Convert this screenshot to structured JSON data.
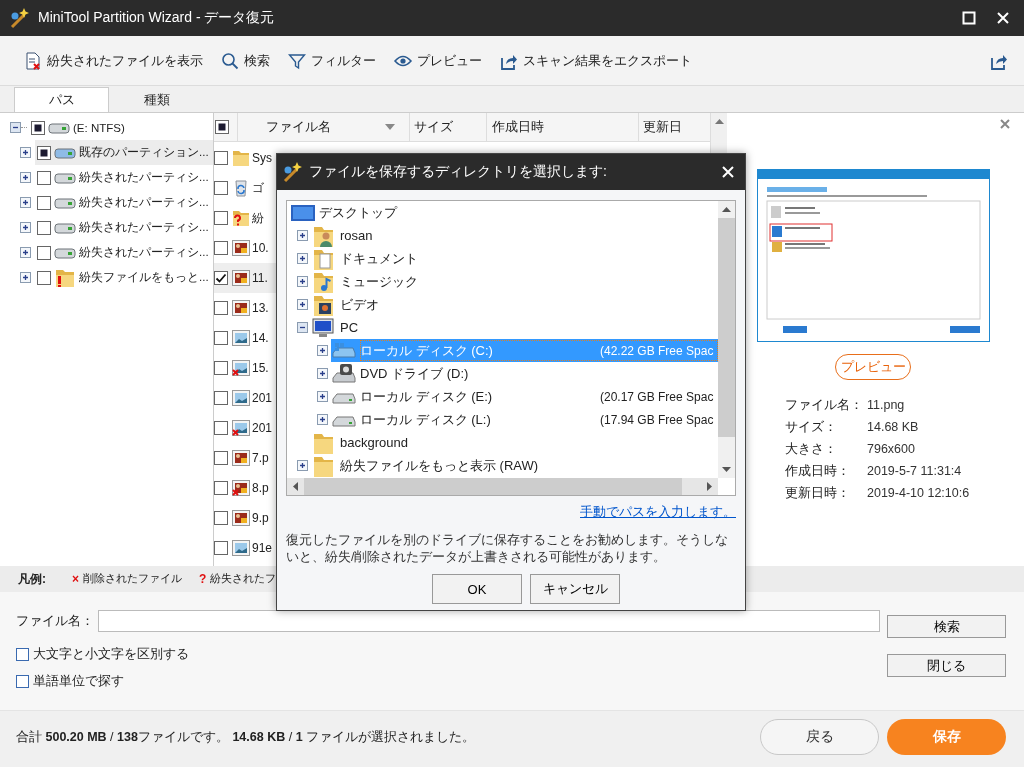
{
  "window": {
    "title": "MiniTool Partition Wizard - データ復元"
  },
  "toolbar": {
    "items": [
      {
        "kind": "show-lost",
        "label": "紛失されたファイルを表示"
      },
      {
        "kind": "search",
        "label": "検索"
      },
      {
        "kind": "filter",
        "label": "フィルター"
      },
      {
        "kind": "preview",
        "label": "プレビュー"
      },
      {
        "kind": "export",
        "label": "スキャン結果をエクスポート"
      }
    ]
  },
  "tabs": [
    {
      "label": "パス",
      "selected": true
    },
    {
      "label": "種類",
      "selected": false
    }
  ],
  "tree": {
    "label": "(E: NTFS)",
    "checked": false,
    "indeterminate": true,
    "expanded": true,
    "children": [
      {
        "label": "既存のパーティション...",
        "kind": "partition",
        "checked": false,
        "indeterminate": true,
        "expanded": false,
        "selected": true
      },
      {
        "label": "紛失されたパーティシ...",
        "kind": "drive",
        "checked": false,
        "indeterminate": false,
        "expanded": false,
        "selected": false
      },
      {
        "label": "紛失されたパーティシ...",
        "kind": "drive",
        "checked": false,
        "indeterminate": false,
        "expanded": false,
        "selected": false
      },
      {
        "label": "紛失されたパーティシ...",
        "kind": "drive",
        "checked": false,
        "indeterminate": false,
        "expanded": false,
        "selected": false
      },
      {
        "label": "紛失されたパーティシ...",
        "kind": "drive",
        "checked": false,
        "indeterminate": false,
        "expanded": false,
        "selected": false
      },
      {
        "label": "紛失ファイルをもっと...",
        "kind": "lost-folder",
        "checked": false,
        "indeterminate": false,
        "expanded": false,
        "selected": false
      }
    ]
  },
  "file_list": {
    "header_checked": false,
    "header_indeterminate": true,
    "columns": [
      "ファイル名",
      "サイズ",
      "作成日時",
      "更新日"
    ],
    "rows": [
      {
        "name": "Sys",
        "kind": "folder",
        "checked": false,
        "selected": false
      },
      {
        "name": "ゴ",
        "kind": "recycle-bin",
        "checked": false,
        "selected": false
      },
      {
        "name": "紛",
        "kind": "lost-folder",
        "checked": false,
        "selected": false
      },
      {
        "name": "10.",
        "kind": "photo",
        "checked": false,
        "selected": false
      },
      {
        "name": "11.",
        "kind": "photo",
        "checked": true,
        "selected": true
      },
      {
        "name": "13.",
        "kind": "photo",
        "checked": false,
        "selected": false
      },
      {
        "name": "14.",
        "kind": "landscape",
        "checked": false,
        "selected": false
      },
      {
        "name": "15.",
        "kind": "landscape-deleted",
        "checked": false,
        "selected": false
      },
      {
        "name": "201",
        "kind": "landscape",
        "checked": false,
        "selected": false
      },
      {
        "name": "201",
        "kind": "landscape-deleted",
        "checked": false,
        "selected": false
      },
      {
        "name": "7.p",
        "kind": "photo",
        "checked": false,
        "selected": false
      },
      {
        "name": "8.p",
        "kind": "photo-deleted",
        "checked": false,
        "selected": false
      },
      {
        "name": "9.p",
        "kind": "photo",
        "checked": false,
        "selected": false
      },
      {
        "name": "91e",
        "kind": "landscape",
        "checked": false,
        "selected": false
      }
    ]
  },
  "preview": {
    "button": "プレビュー",
    "info": [
      {
        "label": "ファイル名：",
        "value": "11.png"
      },
      {
        "label": "サイズ：",
        "value": "14.68 KB"
      },
      {
        "label": "大きさ：",
        "value": "796x600"
      },
      {
        "label": "作成日時：",
        "value": "2019-5-7 11:31:4"
      },
      {
        "label": "更新日時：",
        "value": "2019-4-10 12:10:6"
      }
    ]
  },
  "legend": {
    "title": "凡例:",
    "items": [
      {
        "mark": "×",
        "label": "削除されたファイル"
      },
      {
        "mark": "?",
        "label": "紛失されたフ"
      }
    ]
  },
  "search": {
    "label": "ファイル名：",
    "button": "検索",
    "close_button": "閉じる",
    "options": [
      {
        "label": "大文字と小文字を区別する",
        "checked": false
      },
      {
        "label": "単語単位で探す",
        "checked": false
      }
    ]
  },
  "footer": {
    "summary": "合計 **500.20 MB** / **138**ファイルです。 **14.68 KB** / **1** ファイルが選択されました。",
    "back_button": "戻る",
    "save_button": "保存"
  },
  "dialog": {
    "title": "ファイルを保存するディレクトリを選択します:",
    "tree": {
      "label": "デスクトップ",
      "kind": "desktop",
      "children": [
        {
          "label": "rosan",
          "kind": "user-folder",
          "expandable": true,
          "expanded": false,
          "selected": false
        },
        {
          "label": "ドキュメント",
          "kind": "documents-folder",
          "expandable": true,
          "expanded": false,
          "selected": false
        },
        {
          "label": "ミュージック",
          "kind": "music-folder",
          "expandable": true,
          "expanded": false,
          "selected": false
        },
        {
          "label": "ビデオ",
          "kind": "video-folder",
          "expandable": true,
          "expanded": false,
          "selected": false
        },
        {
          "label": "PC",
          "kind": "pc",
          "expandable": true,
          "expanded": true,
          "selected": false,
          "children": [
            {
              "label": "ローカル ディスク (C:)",
              "free": "(42.22 GB Free Spac",
              "kind": "system-drive",
              "expandable": true,
              "expanded": false,
              "selected": true
            },
            {
              "label": "DVD ドライブ (D:)",
              "kind": "dvd",
              "expandable": true,
              "expanded": false,
              "selected": false
            },
            {
              "label": "ローカル ディスク (E:)",
              "free": "(20.17 GB Free Spac",
              "kind": "drive",
              "expandable": true,
              "expanded": false,
              "selected": false
            },
            {
              "label": "ローカル ディスク (L:)",
              "free": "(17.94 GB Free Spac",
              "kind": "drive",
              "expandable": true,
              "expanded": false,
              "selected": false
            }
          ]
        },
        {
          "label": "background",
          "kind": "folder",
          "expandable": false,
          "selected": false
        },
        {
          "label": "紛失ファイルをもっと表示 (RAW)",
          "kind": "folder",
          "expandable": true,
          "expanded": false,
          "selected": false
        }
      ]
    },
    "link": "手動でパスを入力します。",
    "message": "復元したファイルを別のドライブに保存することをお勧めします。そうしないと、紛失/削除されたデータが上書きされる可能性があります。",
    "buttons": [
      "OK",
      "キャンセル"
    ]
  }
}
